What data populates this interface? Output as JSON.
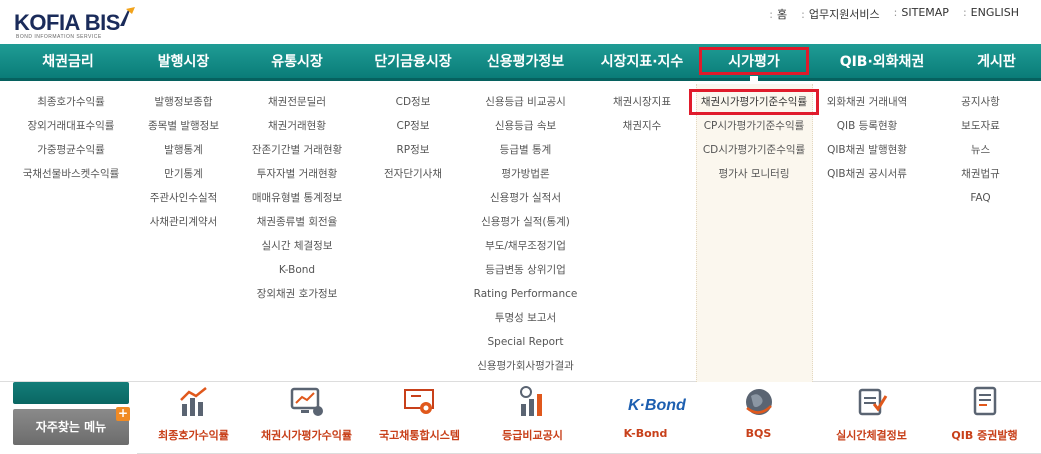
{
  "header": {
    "logo_text": "KOFIA BIS",
    "logo_sub": "BOND INFORMATION SERVICE",
    "util_links": [
      "홈",
      "업무지원서비스",
      "SITEMAP",
      "ENGLISH"
    ]
  },
  "nav": {
    "items": [
      "채권금리",
      "발행시장",
      "유통시장",
      "단기금융시장",
      "신용평가정보",
      "시장지표·지수",
      "시가평가",
      "QIB·외화채권",
      "게시판"
    ],
    "active_index": 6
  },
  "menu": {
    "col0": [
      "최종호가수익률",
      "장외거래대표수익률",
      "가중평균수익률",
      "국채선물바스켓수익률"
    ],
    "col1": [
      "발행정보종합",
      "종목별 발행정보",
      "발행통계",
      "만기통계",
      "주관사인수실적",
      "사채관리계약서"
    ],
    "col2": [
      "채권전문딜러",
      "채권거래현황",
      "잔존기간별 거래현황",
      "투자자별 거래현황",
      "매매유형별 통계정보",
      "채권종류별 회전율",
      "실시간 체결정보",
      "K-Bond",
      "장외채권 호가정보"
    ],
    "col3": [
      "CD정보",
      "CP정보",
      "RP정보",
      "전자단기사채"
    ],
    "col4": [
      "신용등급 비교공시",
      "신용등급 속보",
      "등급별 통계",
      "평가방법론",
      "신용평가 실적서",
      "신용평가 실적(통계)",
      "부도/채무조정기업",
      "등급변동 상위기업",
      "Rating Performance",
      "투명성 보고서",
      "Special Report",
      "신용평가회사평가결과"
    ],
    "col5": [
      "채권시장지표",
      "채권지수"
    ],
    "col6": [
      "채권시가평가기준수익률",
      "CP시가평가기준수익률",
      "CD시가평가기준수익률",
      "평가사 모니터링"
    ],
    "col7": [
      "외화채권 거래내역",
      "QIB 등록현황",
      "QIB채권 발행현황",
      "QIB채권 공시서류"
    ],
    "col8": [
      "공지사항",
      "보도자료",
      "뉴스",
      "채권법규",
      "FAQ"
    ]
  },
  "quick": {
    "faq_label": "자주찾는 메뉴",
    "plus": "+",
    "items": [
      {
        "label": "최종호가수익률",
        "icon": "bar-chart-icon"
      },
      {
        "label": "채권시가평가수익률",
        "icon": "monitor-chart-icon"
      },
      {
        "label": "국고채통합시스템",
        "icon": "gear-board-icon"
      },
      {
        "label": "등급비교공시",
        "icon": "grade-bar-icon"
      },
      {
        "label": "K-Bond",
        "icon": "kbond-logo-icon"
      },
      {
        "label": "BQS",
        "icon": "globe-icon"
      },
      {
        "label": "실시간체결정보",
        "icon": "checklist-icon"
      },
      {
        "label": "QIB 증권발행",
        "icon": "document-icon"
      }
    ]
  }
}
